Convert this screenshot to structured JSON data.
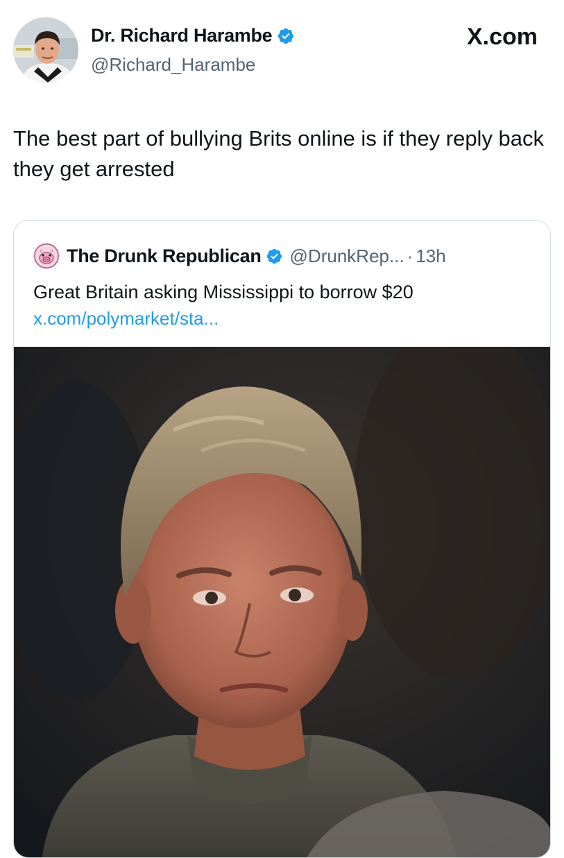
{
  "tweet": {
    "author_name": "Dr. Richard Harambe",
    "author_handle": "@Richard_Harambe",
    "site_logo": "X.com",
    "text": "The best part of bullying Brits online is if they reply back they get arrested",
    "avatar_icon": "profile-photo",
    "verified_icon": "verified-badge-icon"
  },
  "quoted_tweet": {
    "author_name": "The Drunk Republican",
    "author_handle": "@DrunkRep...",
    "separator": "·",
    "time": "13h",
    "text": "Great Britain asking Mississippi to borrow $20",
    "link": "x.com/polymarket/sta...",
    "avatar_icon": "pink-pig-avatar",
    "media": "photo-of-boy"
  },
  "colors": {
    "verified_blue": "#1d9bf0",
    "link_blue": "#1d9bf0",
    "secondary_text": "#536471",
    "border": "#cfd9de"
  }
}
